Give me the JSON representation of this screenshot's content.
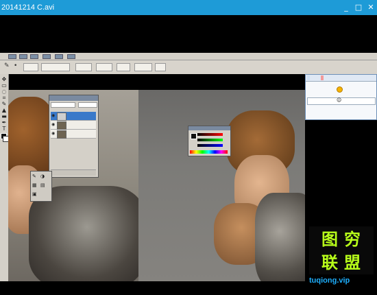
{
  "window": {
    "title": "20141214 C.avi",
    "controls": [
      "_",
      "□",
      "✕"
    ]
  },
  "options_bar": {
    "fields": [
      "",
      "",
      "",
      "",
      "",
      "",
      ""
    ]
  },
  "layers_panel": {
    "header": "",
    "mode_value": "",
    "opacity_value": "",
    "layers": [
      {
        "name": ""
      },
      {
        "name": ""
      },
      {
        "name": ""
      }
    ]
  },
  "qq_chat": {
    "tabs": [
      "",
      ""
    ],
    "messages": [
      {
        "sender": "",
        "text": "",
        "time": ""
      },
      {
        "sender": "",
        "text": "",
        "time": ""
      },
      {
        "sender": "",
        "text": "",
        "time": ""
      }
    ],
    "input_placeholder": ""
  },
  "watermark": {
    "chars": [
      "图",
      "穷",
      "联",
      "盟"
    ],
    "url": "tuqiong.vip",
    "color_chars": "#b8ff1a",
    "color_url": "#1eb0ff"
  },
  "colors": {
    "titlebar": "#1e9bd7",
    "layer_selected": "#3a79c9",
    "ps_chrome": "#d4d0c8"
  }
}
